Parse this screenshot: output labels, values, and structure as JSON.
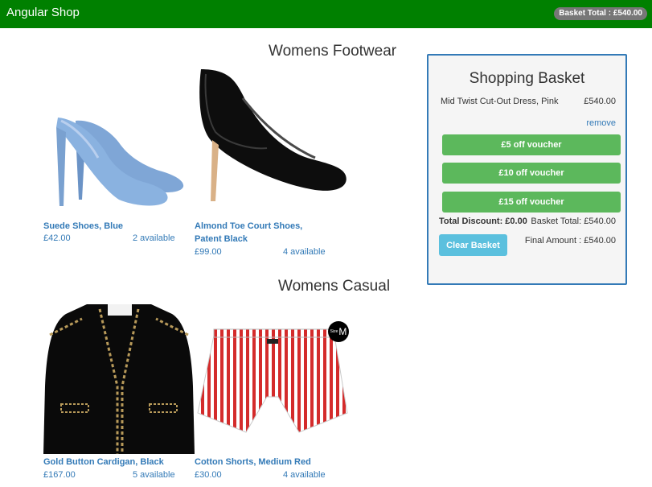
{
  "navbar": {
    "brand": "Angular Shop",
    "basket_badge": "Basket Total : £540.00",
    "color": "#008000"
  },
  "sections": [
    {
      "title": "Womens Footwear",
      "products": [
        {
          "name": "Suede Shoes, Blue",
          "price": "£42.00",
          "available": "2 available"
        },
        {
          "name": "Almond Toe Court Shoes, Patent Black",
          "price": "£99.00",
          "available": "4 available"
        }
      ]
    },
    {
      "title": "Womens Casual",
      "products": [
        {
          "name": "Gold Button Cardigan, Black",
          "price": "£167.00",
          "available": "5 available"
        },
        {
          "name": "Cotton Shorts, Medium Red",
          "price": "£30.00",
          "available": "4 available",
          "tag": "M",
          "tag_prefix": "Size"
        }
      ]
    }
  ],
  "basket": {
    "title": "Shopping Basket",
    "items": [
      {
        "name": "Mid Twist Cut-Out Dress, Pink",
        "price": "£540.00",
        "remove_label": "remove"
      }
    ],
    "vouchers": [
      "£5 off voucher",
      "£10 off voucher",
      "£15 off voucher"
    ],
    "total_discount": "Total Discount: £0.00",
    "basket_total": "Basket Total: £540.00",
    "clear_label": "Clear Basket",
    "final_amount": "Final Amount : £540.00"
  },
  "colors": {
    "link": "#337ab7",
    "success": "#5cb85c",
    "info": "#5bc0de",
    "basket_border": "#337ab7"
  }
}
